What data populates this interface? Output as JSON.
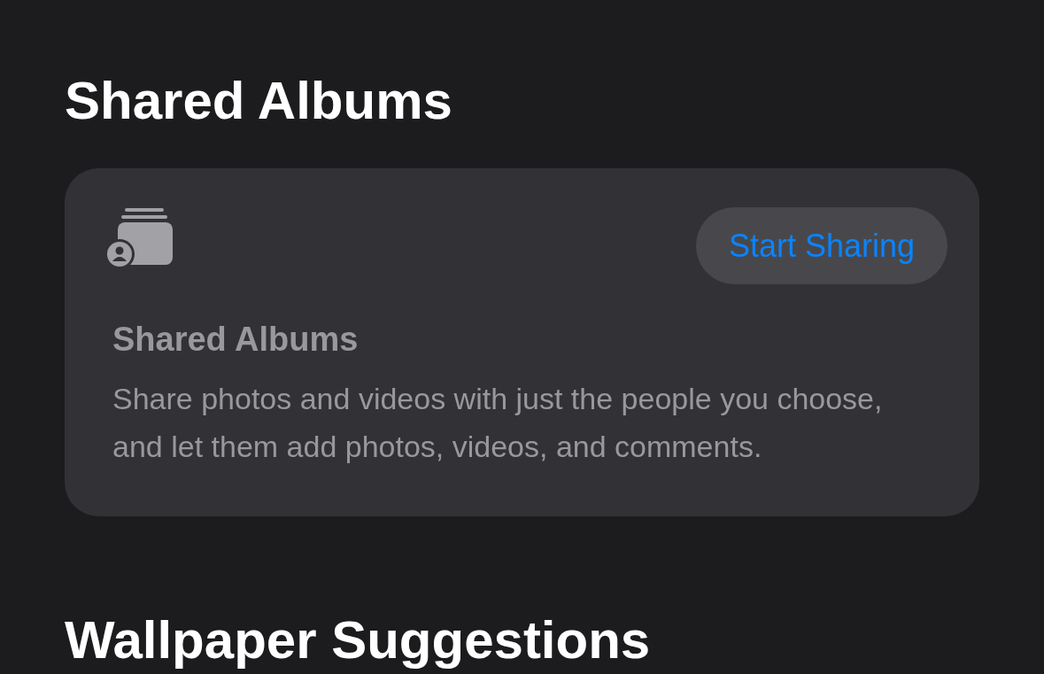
{
  "sections": [
    {
      "title": "Shared Albums",
      "card": {
        "button": "Start Sharing",
        "title": "Shared Albums",
        "description": "Share photos and videos with just the people you choose, and let them add photos, videos, and comments."
      }
    },
    {
      "title": "Wallpaper Suggestions"
    }
  ]
}
